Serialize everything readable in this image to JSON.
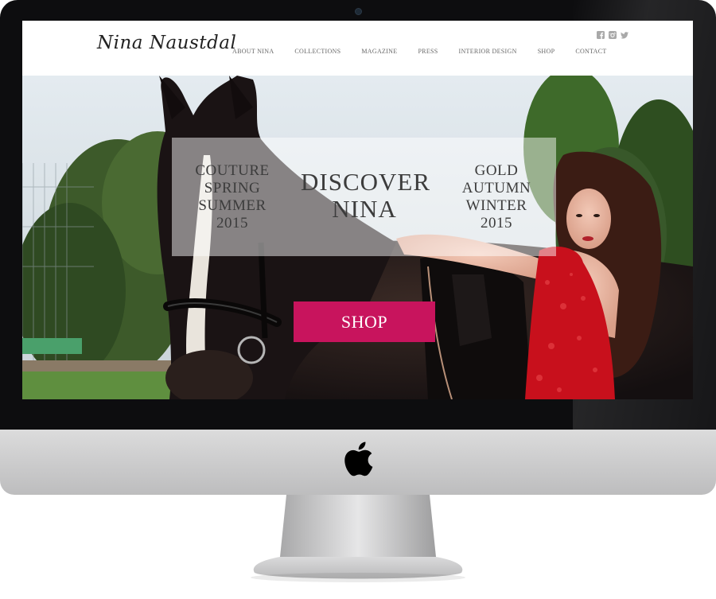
{
  "site": {
    "logo": "Nina Naustdal",
    "nav": [
      {
        "label": "ABOUT NINA"
      },
      {
        "label": "COLLECTIONS"
      },
      {
        "label": "MAGAZINE"
      },
      {
        "label": "PRESS"
      },
      {
        "label": "INTERIOR DESIGN"
      },
      {
        "label": "SHOP"
      },
      {
        "label": "CONTACT"
      }
    ],
    "social": [
      "facebook-icon",
      "instagram-icon",
      "twitter-icon"
    ]
  },
  "hero": {
    "left_column": [
      "COUTURE",
      "SPRING",
      "SUMMER",
      "2015"
    ],
    "center_column": [
      "DISCOVER",
      "NINA"
    ],
    "right_column": [
      "GOLD",
      "AUTUMN",
      "WINTER",
      "2015"
    ],
    "shop_button": "SHOP"
  },
  "colors": {
    "accent": "#c8145d",
    "bezel": "#0d0d0f",
    "header_bg": "#ffffff",
    "dress": "#c8101c"
  }
}
